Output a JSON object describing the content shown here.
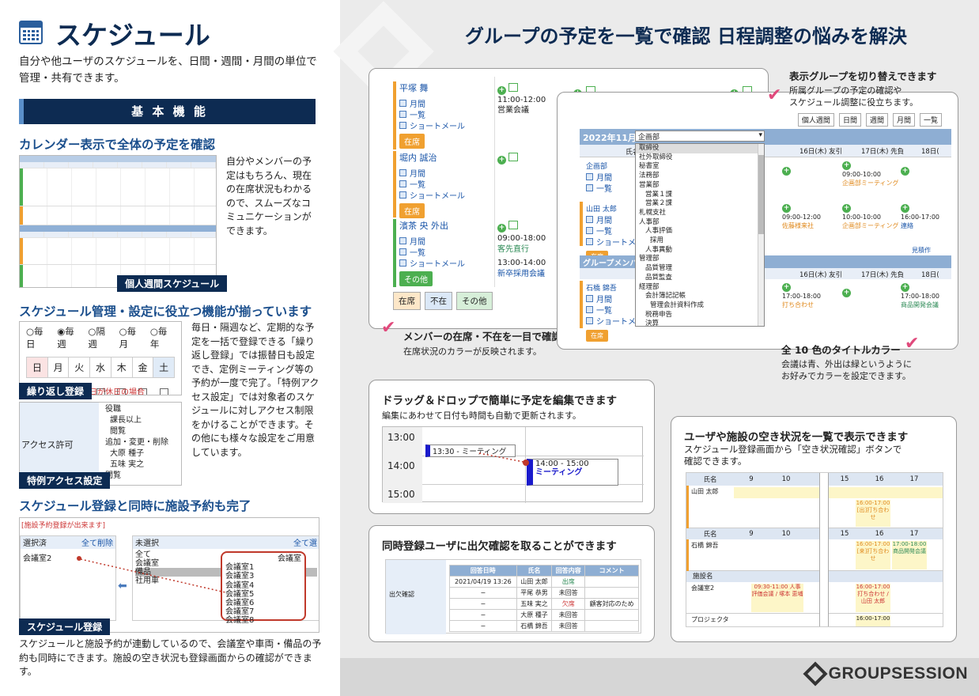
{
  "left": {
    "title": "スケジュール",
    "intro": "自分や他ユーザのスケジュールを、日間・週間・月間の単位で管理・共有できます。",
    "basic_bar": "基 本 機 能",
    "sec1": {
      "heading": "カレンダー表示で全体の予定を確認",
      "body": "自分やメンバーの予定はもちろん、現在の在席状況もわかるので、スムーズなコミュニケーションができます。",
      "caption": "個人週間スケジュール"
    },
    "sec2": {
      "heading": "スケジュール管理・設定に役立つ機能が揃っています",
      "body": "毎日・隔週など、定期的な予定を一括で登録できる「繰り返し登録」では振替日も設定でき、定例ミーティング等の予約が一度で完了。「特例アクセス設定」では対象者のスケジュールに対しアクセス制限をかけることができます。その他にも様々な設定をご用意しています。",
      "radios": [
        "○毎日",
        "◉毎週",
        "○隔週",
        "○毎月",
        "○毎年"
      ],
      "days": [
        "日",
        "月",
        "火",
        "水",
        "木",
        "金",
        "土"
      ],
      "repeat_caption": "繰り返し登録",
      "repeat_note": "日が休日の場合",
      "access_label": "アクセス許可",
      "access_items": [
        "役職",
        "課長以上",
        "閲覧",
        "追加・変更・削除",
        "大原 種子",
        "五味 実之",
        "閲覧"
      ],
      "access_caption": "特例アクセス設定"
    },
    "sec3": {
      "heading": "スケジュール登録と同時に施設予約も完了",
      "warn": "[施設予約登録が出来ます]",
      "selected_label": "選択済",
      "delete_all": "全て削除",
      "selected_item": "会議室2",
      "unselected_label": "未選択",
      "select_all": "全て選",
      "groups": [
        "全て",
        "会議室",
        "備品",
        "社用車"
      ],
      "room_header": "会議室",
      "rooms": [
        "会議室1",
        "会議室3",
        "会議室4",
        "会議室5",
        "会議室6",
        "会議室7",
        "会議室8"
      ],
      "caption": "スケジュール登録",
      "body": "スケジュールと施設予約が連動しているので、会議室や車両・備品の予約も同時にできます。施設の空き状況も登録画面からの確認ができます。"
    }
  },
  "right": {
    "title": "グループの予定を一覧で確認 日程調整の悩みを解決",
    "callout_group": {
      "heading": "表示グループを切り替えできます",
      "body1": "所属グループの予定の確認や",
      "body2": "スケジュール調整に役立ちます。"
    },
    "callout_presence": {
      "heading": "メンバーの在席・不在を一目で確認",
      "body": "在席状況のカラーが反映されます。"
    },
    "callout_color": {
      "heading": "全 10 色のタイトルカラー",
      "body1": "会議は青、外出は緑というように",
      "body2": "お好みでカラーを設定できます。"
    },
    "members": [
      {
        "name": "平塚 舞",
        "status": "在席",
        "time": "11:00-12:00",
        "event": "営業会議"
      },
      {
        "name": "堀内 誠治",
        "status": "在席",
        "time": "",
        "event": ""
      },
      {
        "name": "濱茶 央 外出",
        "status": "その他",
        "time": "09:00-18:00",
        "event": "客先直行",
        "time2": "13:00-14:00",
        "event2": "新卒採用会議"
      }
    ],
    "menu": [
      "月間",
      "一覧",
      "ショートメール"
    ],
    "legend": [
      "在席",
      "不在",
      "その他"
    ],
    "toolbar": [
      "個人週間",
      "日間",
      "週間",
      "月間",
      "一覧"
    ],
    "month_label": "2022年11月",
    "group_select": "企画部",
    "col_name": "氏名",
    "col_days": [
      "16日(木) 友引",
      "17日(木) 先負",
      "18日("
    ],
    "group_rows": [
      {
        "name": "企画部"
      },
      {
        "name": "山田 太郎",
        "e1t": "09:00-12:00",
        "e1": "佐藤様来社",
        "e2t": "10:00-10:00",
        "e2": "企画部ミーティング",
        "e3t": "16:00-17:00",
        "e3": "連絡"
      }
    ],
    "group_row1_time": "09:00-10:00",
    "group_row1_event": "企画部ミーティング",
    "group_member_bar": "グループメンバー",
    "see_more": "見積作",
    "ishibashi": {
      "name": "石橋 錦吾",
      "t1": "17:00-18:00",
      "e1": "打ち合わせ",
      "t2": "17:00-18:00",
      "e2": "商品開発会議"
    },
    "dropdown": [
      "取締役",
      "社外取締役",
      "秘書室",
      "法務部",
      "営業部",
      "営業１課",
      "営業２課",
      "札幌支社",
      "人事部",
      "人事評価",
      "採用",
      "人事異動",
      "管理部",
      "品質管理",
      "品質監査",
      "経理部",
      "会計簿記記帳",
      "管理会計資料作成",
      "税務申告",
      "決算"
    ],
    "drag": {
      "heading": "ドラッグ＆ドロップで簡単に予定を編集できます",
      "body": "編集にあわせて日付も時間も自動で更新されます。",
      "times": [
        "13:00",
        "14:00",
        "15:00"
      ],
      "ev1": "13:30 - ミーティング",
      "ev2_time": "14:00 - 15:00",
      "ev2_name": "ミーティング"
    },
    "attend": {
      "heading": "同時登録ユーザに出欠確認を取ることができます",
      "label": "出欠確認",
      "headers": [
        "回答日時",
        "氏名",
        "回答内容",
        "コメント"
      ],
      "rows": [
        [
          "2021/04/19 13:26",
          "山田 太郎",
          "出席",
          ""
        ],
        [
          "−",
          "平尾 恭男",
          "未回答",
          ""
        ],
        [
          "−",
          "五味 実之",
          "欠席",
          "顧客対応のため"
        ],
        [
          "−",
          "大原 種子",
          "未回答",
          ""
        ],
        [
          "−",
          "石橋 錦吾",
          "未回答",
          ""
        ]
      ]
    },
    "avail": {
      "heading": "ユーザや施設の空き状況を一覧で表示できます",
      "body1": "スケジュール登録画面から「空き状況確認」ボタンで",
      "body2": "確認できます。",
      "col_name": "氏名",
      "col_facility": "施設名",
      "hours": [
        "9",
        "10",
        "15",
        "16",
        "17"
      ],
      "user1": "山田 太郎",
      "user1_ev": "16:00-17:00 [出]打ち合わせ",
      "user2": "石橋 錦吾",
      "user2_ev1": "16:00-17:00 [来]打ち合わせ",
      "user2_ev2": "17:00-18:00 商品開発会議",
      "fac1": "会議室2",
      "fac1_ev1": "09:30-11:00 人事評価会議 / 塚本 恵埔",
      "fac1_ev2": "16:00-17:00 打ち合わせ / 山田 太郎",
      "fac2": "プロジェクタ",
      "fac2_ev": "16:00-17:00"
    },
    "logo": "GROUPSESSION"
  },
  "colors": {
    "navy": "#0d2b52",
    "accent_blue": "#1a4e8c",
    "pink": "#e04a7c",
    "orange": "#f0a030",
    "green": "#4caf50"
  }
}
